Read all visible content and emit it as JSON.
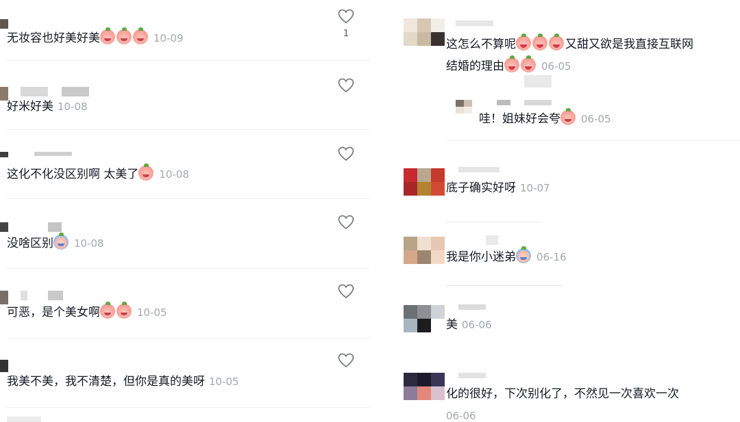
{
  "left_comments": [
    {
      "text": "无妆容也好美好美",
      "emojis": [
        "emoji",
        "emoji",
        "emoji"
      ],
      "date": "10-09",
      "likes": "1"
    },
    {
      "text": "好米好美",
      "emojis": [],
      "date": "10-08",
      "likes": ""
    },
    {
      "text": "这化不化没区别啊 太美了",
      "emojis": [
        "emoji"
      ],
      "date": "10-08",
      "likes": ""
    },
    {
      "text": "没啥区别",
      "emojis": [
        "emoji-blue"
      ],
      "date": "10-08",
      "likes": ""
    },
    {
      "text": "可恶，是个美女啊",
      "emojis": [
        "emoji",
        "emoji"
      ],
      "date": "10-05",
      "likes": ""
    },
    {
      "text": "我美不美，我不清楚，但你是真的美呀",
      "emojis": [],
      "date": "10-05",
      "likes": ""
    }
  ],
  "right_comments": [
    {
      "line1": "这怎么不算呢",
      "emojis1": [
        "emoji-hearts",
        "emoji-hearts",
        "emoji-hearts"
      ],
      "line1_after": "又甜又欲是我直接互联网",
      "line2": "结婚的理由",
      "emojis2": [
        "emoji-hearts",
        "emoji-hearts"
      ],
      "date": "06-05"
    },
    {
      "reply": "哇！姐妹好会夸",
      "emojis": [
        "emoji"
      ],
      "date": "06-05"
    },
    {
      "text": "底子确实好呀",
      "date": "10-07"
    },
    {
      "text": "我是你小迷弟",
      "emojis": [
        "emoji-blue"
      ],
      "date": "06-16"
    },
    {
      "text": "美",
      "date": "06-06"
    },
    {
      "text": "化的很好，下次别化了，不然见一次喜欢一次",
      "date": "06-06"
    }
  ],
  "colors": {
    "text": "#161823",
    "date": "#a3a6ad",
    "separator": "#eeeeef",
    "heart": "#7b7d84"
  },
  "icons": {
    "like": "heart-outline-icon"
  }
}
